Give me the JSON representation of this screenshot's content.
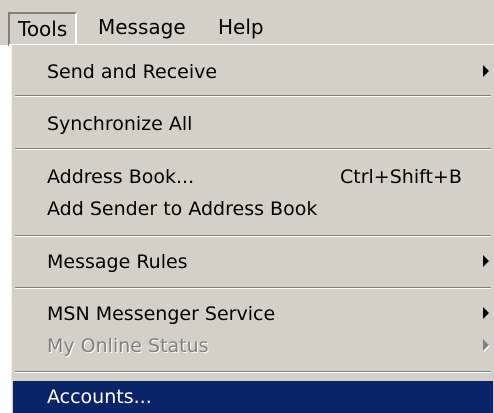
{
  "menubar": {
    "items": [
      {
        "label": "Tools",
        "active": true
      },
      {
        "label": "Message",
        "active": false
      },
      {
        "label": "Help",
        "active": false
      }
    ]
  },
  "tools_menu": {
    "items": [
      {
        "label": "Send and Receive",
        "has_submenu": true
      },
      {
        "label": "Synchronize All"
      },
      {
        "label": "Address Book...",
        "shortcut": "Ctrl+Shift+B"
      },
      {
        "label": "Add Sender to Address Book"
      },
      {
        "label": "Message Rules",
        "has_submenu": true
      },
      {
        "label": "MSN Messenger Service",
        "has_submenu": true
      },
      {
        "label": "My Online Status",
        "has_submenu": true,
        "disabled": true
      },
      {
        "label": "Accounts...",
        "highlighted": true
      }
    ]
  },
  "colors": {
    "menu_background": "#d4d0c8",
    "highlight_background": "#0a246a",
    "highlight_text": "#ffffff",
    "disabled_text": "#808080"
  }
}
